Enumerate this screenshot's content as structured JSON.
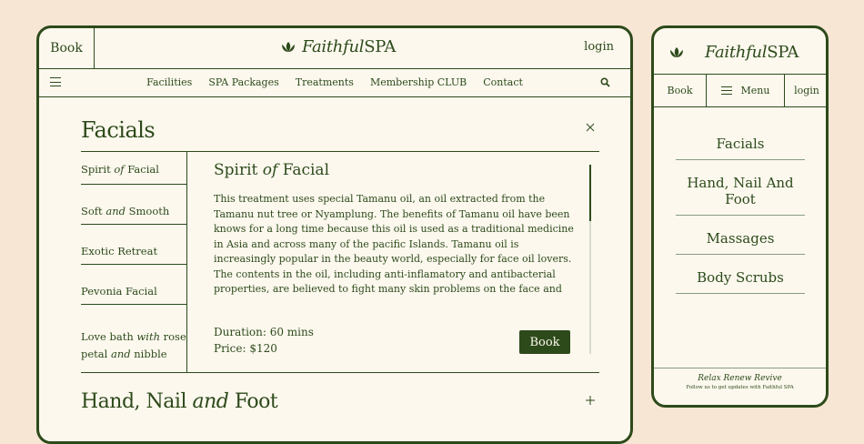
{
  "brand": {
    "name_italic": "Faithful",
    "name_regular": "SPA"
  },
  "desktop": {
    "header": {
      "book": "Book",
      "login": "login"
    },
    "nav": [
      "Facilities",
      "SPA Packages",
      "Treatments",
      "Membership CLUB",
      "Contact"
    ],
    "accordion_open": {
      "title": "Facials"
    },
    "sidebar": [
      {
        "a": "Spirit ",
        "i": "of",
        "b": " Facial"
      },
      {
        "a": "Soft ",
        "i": "and",
        "b": " Smooth"
      },
      {
        "a": "Exotic Retreat",
        "i": "",
        "b": ""
      },
      {
        "a": "Pevonia Facial",
        "i": "",
        "b": ""
      },
      {
        "a": "Love bath ",
        "i": "with",
        "b": " rose",
        "a2": "petal ",
        "i2": "and",
        "b2": " nibble"
      }
    ],
    "content": {
      "title_a": "Spirit ",
      "title_i": "of",
      "title_b": " Facial",
      "body": "This treatment uses special Tamanu oil, an oil extracted from the Tamanu nut tree or Nyamplung. The benefits of Tamanu oil have been knows for a long time because this oil is used as a traditional medicine in Asia and across many of the pacific Islands. Tamanu oil is increasingly popular in the beauty world, especially for face oil lovers. The contents in the oil, including anti-inflamatory and antibacterial properties, are believed to fight many skin problems on the face and body, starting from healing scars and treating acne prone skin, to soothing sun-",
      "duration": "Duration: 60 mins",
      "price": "Price: $120",
      "book_button": "Book",
      "scroll_fraction": 0.3
    },
    "accordion_closed": {
      "a": "Hand, Nail ",
      "i": "and",
      "b": " Foot"
    }
  },
  "mobile": {
    "bar": {
      "book": "Book",
      "menu": "Menu",
      "login": "login"
    },
    "menu_items": [
      "Facials",
      "Hand, Nail And Foot",
      "Massages",
      "Body Scrubs"
    ],
    "footer": {
      "tagline": "Relax Renew Revive",
      "follow": "Follow us to get updates with Faithful SPA"
    }
  },
  "colors": {
    "brand": "#2d4a1a",
    "panel": "#fcf8ee",
    "background": "#f8e6d5"
  },
  "icons": {
    "logo": "lotus-icon",
    "menu": "hamburger-icon",
    "search": "search-icon",
    "close": "close-icon",
    "expand": "plus-icon"
  }
}
